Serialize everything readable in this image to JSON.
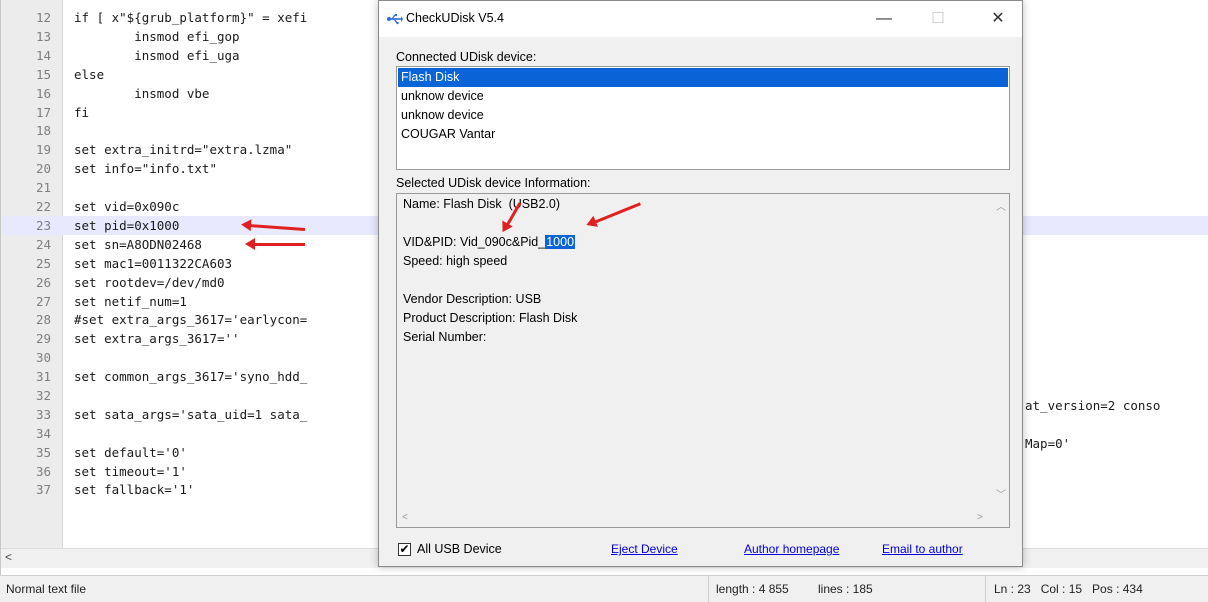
{
  "editor": {
    "lines": [
      {
        "num": "12",
        "text": "if [ x\"${grub_platform}\" = xefi"
      },
      {
        "num": "13",
        "text": "        insmod efi_gop"
      },
      {
        "num": "14",
        "text": "        insmod efi_uga"
      },
      {
        "num": "15",
        "text": "else"
      },
      {
        "num": "16",
        "text": "        insmod vbe"
      },
      {
        "num": "17",
        "text": "fi"
      },
      {
        "num": "18",
        "text": ""
      },
      {
        "num": "19",
        "text": "set extra_initrd=\"extra.lzma\""
      },
      {
        "num": "20",
        "text": "set info=\"info.txt\""
      },
      {
        "num": "21",
        "text": ""
      },
      {
        "num": "22",
        "text": "set vid=0x090c"
      },
      {
        "num": "23",
        "text": "set pid=0x1000"
      },
      {
        "num": "24",
        "text": "set sn=A8ODN02468"
      },
      {
        "num": "25",
        "text": "set mac1=0011322CA603"
      },
      {
        "num": "26",
        "text": "set rootdev=/dev/md0"
      },
      {
        "num": "27",
        "text": "set netif_num=1"
      },
      {
        "num": "28",
        "text": "#set extra_args_3617='earlycon="
      },
      {
        "num": "29",
        "text": "set extra_args_3617=''"
      },
      {
        "num": "30",
        "text": ""
      },
      {
        "num": "31",
        "text": "set common_args_3617='syno_hdd_"
      },
      {
        "num": "32",
        "text": ""
      },
      {
        "num": "33",
        "text": "set sata_args='sata_uid=1 sata_"
      },
      {
        "num": "34",
        "text": ""
      },
      {
        "num": "35",
        "text": "set default='0'"
      },
      {
        "num": "36",
        "text": "set timeout='1'"
      },
      {
        "num": "37",
        "text": "set fallback='1'"
      }
    ],
    "line31_right": "at_version=2 conso",
    "line33_right": "Map=0'",
    "scroll_left": "<"
  },
  "statusbar": {
    "file_type": "Normal text file",
    "length": "length : 4 855",
    "lines": "lines : 185",
    "position": "Ln : 23   Col : 15   Pos : 434"
  },
  "dialog": {
    "title": "CheckUDisk V5.4",
    "minimize": "—",
    "maximize": "☐",
    "close": "✕",
    "connected_label": "Connected UDisk device:",
    "devices": [
      {
        "label": "Flash Disk",
        "selected": true
      },
      {
        "label": "unknow device",
        "selected": false
      },
      {
        "label": "unknow device",
        "selected": false
      },
      {
        "label": "COUGAR Vantar",
        "selected": false
      }
    ],
    "info_label": "Selected UDisk device Information:",
    "info": {
      "name": "Name: Flash Disk  (USB2.0)",
      "vidpid_prefix": "VID&PID: Vid_090c&Pid_",
      "vidpid_highlight": "1000",
      "speed": "Speed: high speed",
      "vendor": "Vendor Description: USB",
      "product": "Product Description: Flash Disk",
      "serial": "Serial Number:"
    },
    "checkbox_label": "All USB Device",
    "checkbox_checked": true,
    "checkbox_mark": "✔",
    "eject": "Eject Device",
    "author_home": "Author homepage",
    "email": "Email to author"
  },
  "colors": {
    "selection": "#0a64d7",
    "annotation_arrow": "#e02020",
    "active_line": "#e8e8ff",
    "link": "#0000dd"
  }
}
